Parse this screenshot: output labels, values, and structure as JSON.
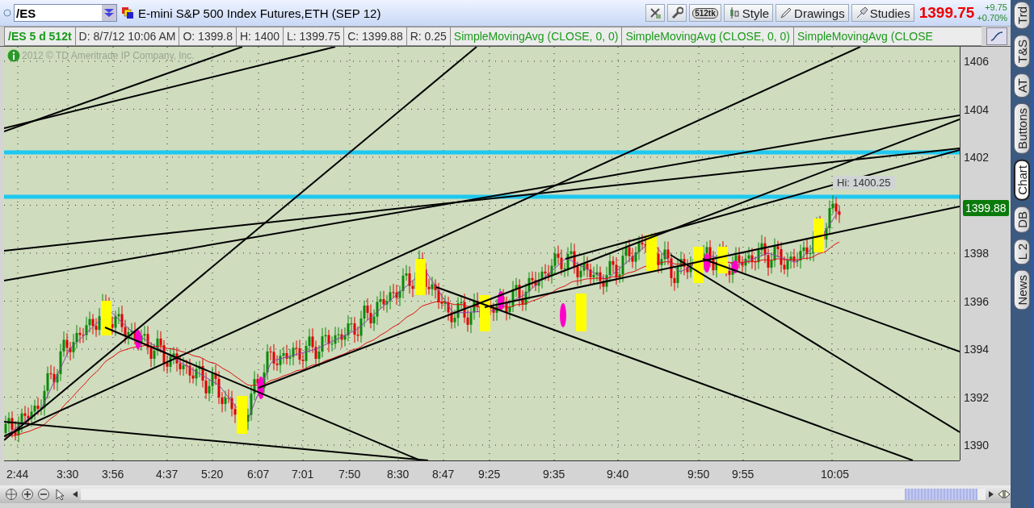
{
  "symbol_field": {
    "value": "/ES"
  },
  "instrument": "E-mini S&P 500 Index Futures,ETH (SEP 12)",
  "toolbar": [
    {
      "kind": "icon"
    },
    {
      "kind": "icon"
    },
    {
      "kind": "badge",
      "label": "512tk"
    },
    {
      "kind": "button",
      "label": "Style"
    },
    {
      "kind": "button",
      "label": "Drawings"
    },
    {
      "kind": "button",
      "label": "Studies"
    }
  ],
  "quote": {
    "last": "1399.75",
    "change": "+9.75",
    "change_percent": "+0.70%"
  },
  "info_bar": {
    "symbol": "/ES 5 d 512t",
    "cells": [
      "D: 8/7/12 10:06 AM",
      "O: 1399.8",
      "H: 1400",
      "L: 1399.75",
      "C: 1399.88",
      "R: 0.25"
    ],
    "studies": [
      "SimpleMovingAvg (CLOSE, 0, 0)",
      "SimpleMovingAvg (CLOSE, 0, 0)",
      "SimpleMovingAvg (CLOSE"
    ]
  },
  "chart": {
    "copyright": "2012 © TD Ameritrade IP Company, Inc.",
    "hi_label": "Hi: 1400.25",
    "current_price": "1399.88",
    "price_axis": [
      "1406",
      "1404",
      "1402",
      "1398",
      "1396",
      "1394",
      "1392",
      "1390"
    ],
    "time_axis": [
      "2:44",
      "3:30",
      "3:56",
      "4:37",
      "5:20",
      "6:07",
      "7:01",
      "7:50",
      "8:30",
      "8:47",
      "9:25",
      "9:35",
      "9:40",
      "9:50",
      "9:55",
      "10:05"
    ]
  },
  "side_tabs": [
    {
      "label": "Trd",
      "selected": false
    },
    {
      "label": "T&S",
      "selected": false
    },
    {
      "label": "AT",
      "selected": false
    },
    {
      "label": "Buttons",
      "selected": false
    },
    {
      "label": "Chart",
      "selected": true
    },
    {
      "label": "DB",
      "selected": false
    },
    {
      "label": "L 2",
      "selected": false
    },
    {
      "label": "News",
      "selected": false
    }
  ]
}
